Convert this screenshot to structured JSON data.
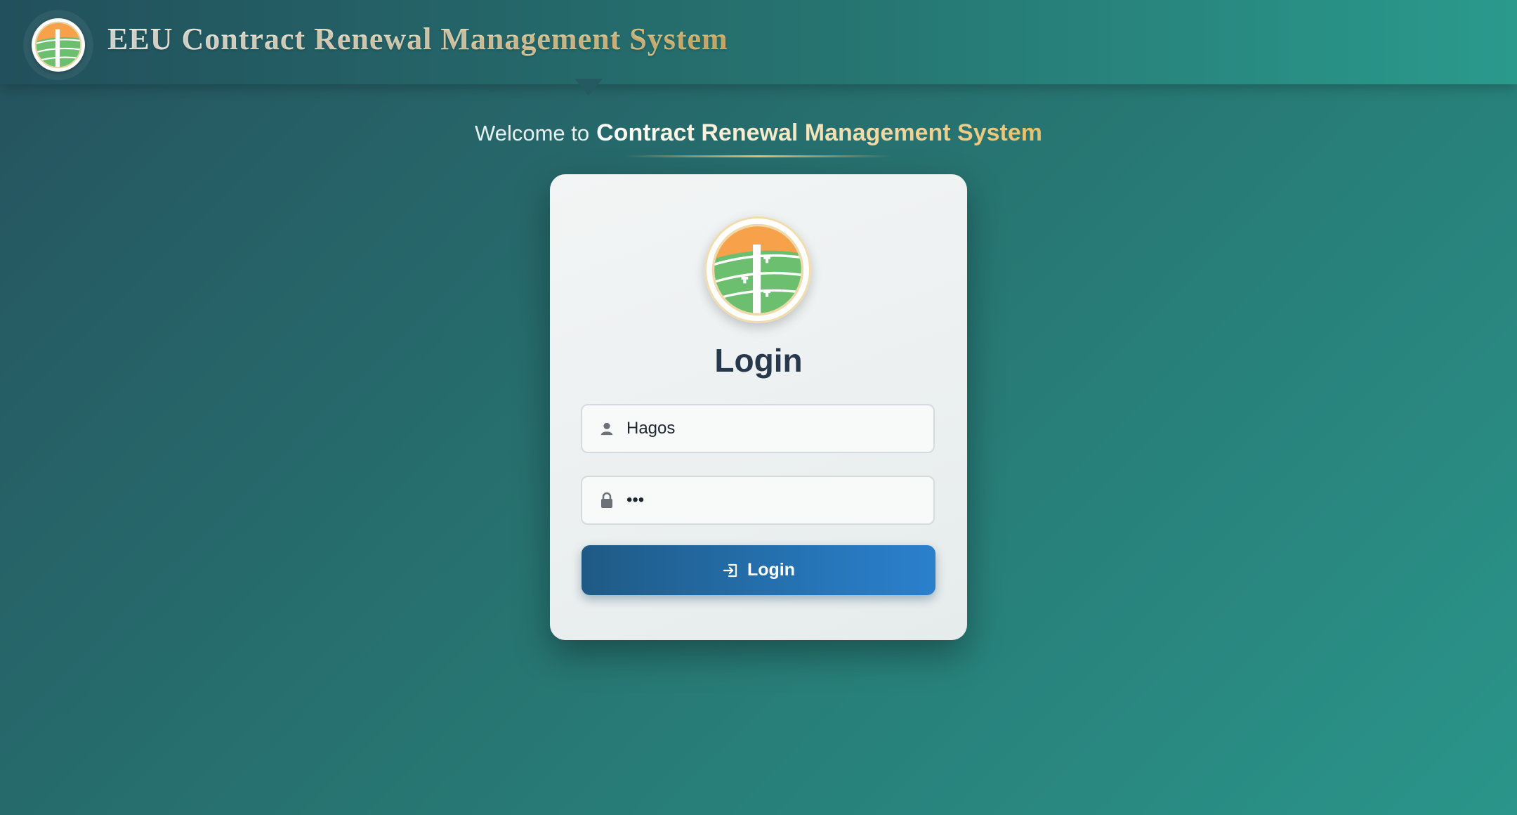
{
  "header": {
    "title": "EEU Contract Renewal Management System",
    "logo_icon": "eeu-logo-icon"
  },
  "welcome": {
    "prefix": "Welcome to",
    "system_name": "Contract Renewal Management System"
  },
  "login_card": {
    "logo_icon": "eeu-logo-icon",
    "title": "Login",
    "username": {
      "icon": "user-icon",
      "value": "Hagos"
    },
    "password": {
      "icon": "lock-icon",
      "value": "•••"
    },
    "submit": {
      "icon": "sign-in-icon",
      "label": "Login"
    }
  },
  "colors": {
    "accent_gold": "#e8c06c",
    "button_blue": "#2676ba",
    "logo_orange": "#f7a24a",
    "logo_green": "#6cbf6e"
  }
}
